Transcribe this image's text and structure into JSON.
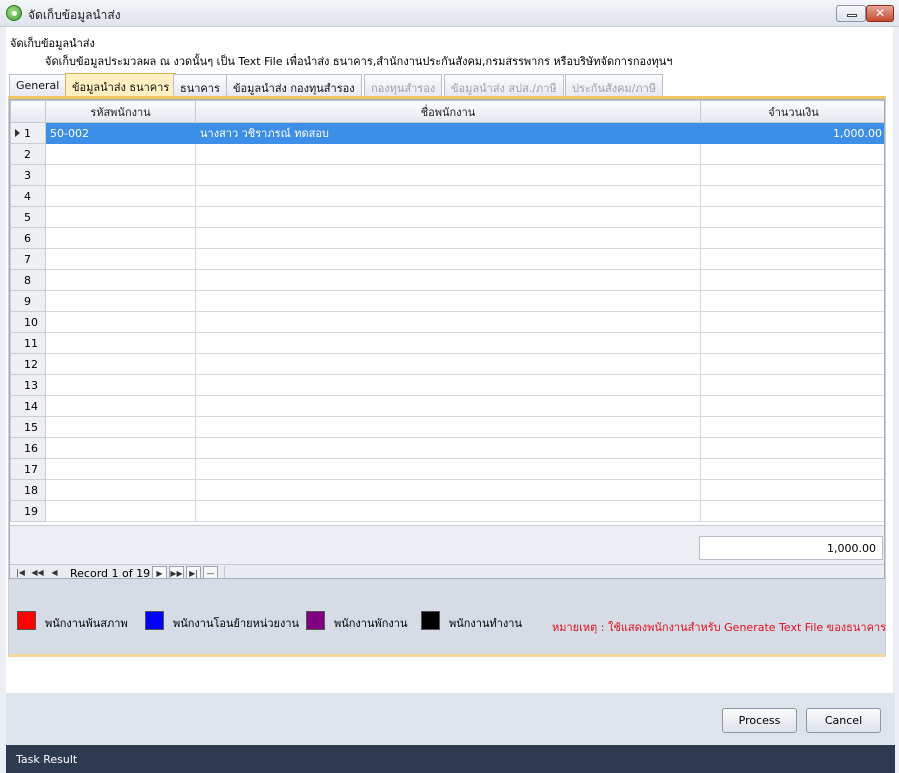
{
  "window": {
    "title": "จัดเก็บข้อมูลนำส่ง",
    "min_label": "—",
    "close_label": "✕"
  },
  "header": {
    "line1": "จัดเก็บข้อมูลนำส่ง",
    "line2": "จัดเก็บข้อมูลประมวลผล ณ งวดนั้นๆ เป็น Text File เพื่อนำส่ง ธนาคาร,สำนักงานประกันสังคม,กรมสรรพากร หรือบริษัทจัดการกองทุนฯ"
  },
  "tabs": [
    {
      "label": "General",
      "state": "normal"
    },
    {
      "label": "ข้อมูลนำส่ง ธนาคาร",
      "state": "active"
    },
    {
      "label": "ธนาคาร",
      "state": "normal"
    },
    {
      "label": "ข้อมูลนำส่ง กองทุนสำรอง",
      "state": "normal"
    },
    {
      "label": "กองทุนสำรอง",
      "state": "disabled"
    },
    {
      "label": "ข้อมูลนำส่ง สปส./ภาษี",
      "state": "disabled"
    },
    {
      "label": "ประกันสังคม/ภาษี",
      "state": "disabled"
    }
  ],
  "grid": {
    "columns": [
      "รหัสพนักงาน",
      "ชื่อพนักงาน",
      "จำนวนเงิน"
    ],
    "rows": [
      {
        "num": "1",
        "code": "50-002",
        "name": "นางสาว วชิราภรณ์ ทดสอบ",
        "amount": "1,000.00",
        "selected": true
      },
      {
        "num": "2"
      },
      {
        "num": "3"
      },
      {
        "num": "4"
      },
      {
        "num": "5"
      },
      {
        "num": "6"
      },
      {
        "num": "7"
      },
      {
        "num": "8"
      },
      {
        "num": "9"
      },
      {
        "num": "10"
      },
      {
        "num": "11"
      },
      {
        "num": "12"
      },
      {
        "num": "13"
      },
      {
        "num": "14"
      },
      {
        "num": "15"
      },
      {
        "num": "16"
      },
      {
        "num": "17"
      },
      {
        "num": "18"
      },
      {
        "num": "19"
      }
    ],
    "total": "1,000.00"
  },
  "navigator": {
    "record_text": "Record 1 of 19"
  },
  "legend": [
    {
      "label": "พนักงานพ้นสภาพ",
      "color": "#ff0000"
    },
    {
      "label": "พนักงานโอนย้ายหน่วยงาน",
      "color": "#0000ff"
    },
    {
      "label": "พนักงานพักงาน",
      "color": "#800080"
    },
    {
      "label": "พนักงานทำงาน",
      "color": "#000000"
    }
  ],
  "note": "หมายเหตุ : ใช้แสดงพนักงานสำหรับ Generate Text File ของธนาคาร",
  "buttons": {
    "process": "Process",
    "cancel": "Cancel"
  },
  "task_result": "Task Result"
}
